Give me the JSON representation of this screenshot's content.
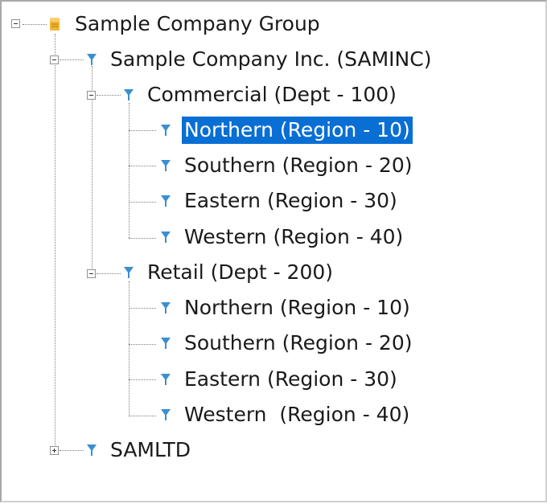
{
  "tree": {
    "root": {
      "label": "Sample Company Group",
      "icon": "database-icon",
      "expanded": true
    },
    "company": {
      "label": "Sample Company Inc. (SAMINC)",
      "icon": "filter-icon",
      "expanded": true
    },
    "dept_commercial": {
      "label": "Commercial (Dept - 100)",
      "icon": "filter-icon",
      "expanded": true,
      "regions": [
        {
          "label": "Northern (Region - 10)",
          "selected": true
        },
        {
          "label": "Southern (Region - 20)"
        },
        {
          "label": "Eastern (Region - 30)"
        },
        {
          "label": "Western (Region - 40)"
        }
      ]
    },
    "dept_retail": {
      "label": "Retail (Dept - 200)",
      "icon": "filter-icon",
      "expanded": true,
      "regions": [
        {
          "label": "Northern (Region - 10)"
        },
        {
          "label": "Southern (Region - 20)"
        },
        {
          "label": "Eastern (Region - 30)"
        },
        {
          "label": "Western  (Region - 40)"
        }
      ]
    },
    "samltd": {
      "label": "SAMLTD",
      "icon": "filter-icon",
      "expanded": false
    }
  },
  "colors": {
    "selection": "#0a6fd4",
    "filter_icon": "#3a8fd0",
    "database_icon": "#f2b632"
  }
}
